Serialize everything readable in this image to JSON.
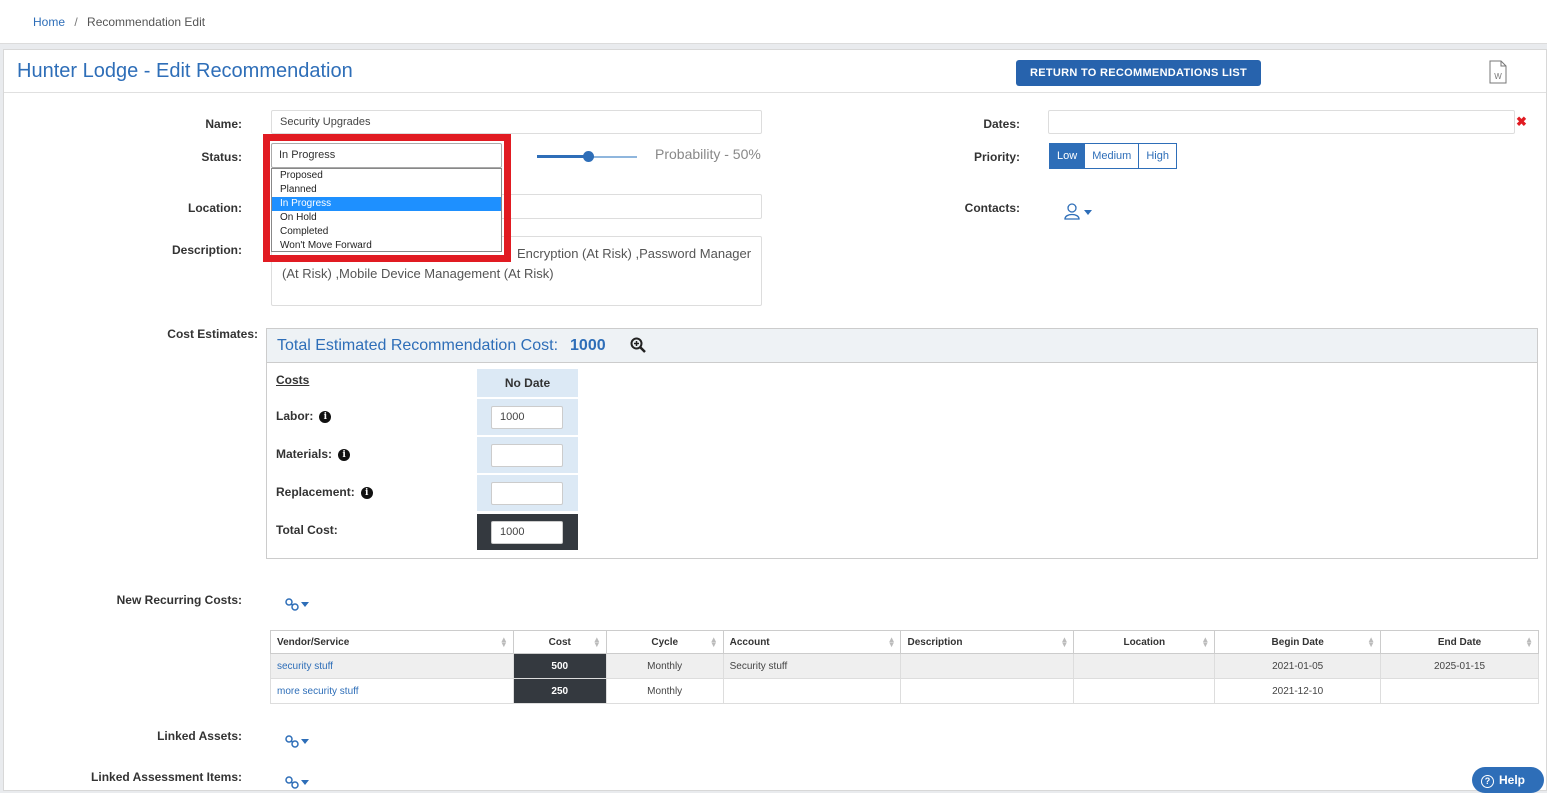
{
  "breadcrumb": {
    "home": "Home",
    "separator": "/",
    "current": "Recommendation Edit"
  },
  "header": {
    "title": "Hunter Lodge - Edit Recommendation",
    "return_button": "RETURN TO RECOMMENDATIONS LIST"
  },
  "form": {
    "name_label": "Name:",
    "name_value": "Security Upgrades",
    "status_label": "Status:",
    "status_value": "In Progress",
    "status_options": [
      "Proposed",
      "Planned",
      "In Progress",
      "On Hold",
      "Completed",
      "Won't Move Forward"
    ],
    "probability_text": "Probability - 50%",
    "probability_value": 50,
    "location_label": "Location:",
    "description_label": "Description:",
    "description_line1": "Encryption (At Risk) ,Password Manager",
    "description_line2": "(At Risk) ,Mobile Device Management (At Risk)",
    "dates_label": "Dates:",
    "priority_label": "Priority:",
    "priority_options": [
      "Low",
      "Medium",
      "High"
    ],
    "priority_selected": "Low",
    "contacts_label": "Contacts:"
  },
  "costs": {
    "section_label": "Cost Estimates:",
    "total_title": "Total Estimated Recommendation Cost:",
    "total_value": "1000",
    "costs_header": "Costs",
    "column_header": "No Date",
    "labor_label": "Labor:",
    "labor_value": "1000",
    "materials_label": "Materials:",
    "materials_value": "",
    "replacement_label": "Replacement:",
    "replacement_value": "",
    "total_label": "Total Cost:",
    "total_cost_value": "1000"
  },
  "recurring": {
    "label": "New Recurring Costs:",
    "columns": [
      "Vendor/Service",
      "Cost",
      "Cycle",
      "Account",
      "Description",
      "Location",
      "Begin Date",
      "End Date"
    ],
    "rows": [
      {
        "vendor": "security stuff",
        "cost": "500",
        "cycle": "Monthly",
        "account": "Security stuff",
        "description": "",
        "location": "",
        "begin": "2021-01-05",
        "end": "2025-01-15"
      },
      {
        "vendor": "more security stuff",
        "cost": "250",
        "cycle": "Monthly",
        "account": "",
        "description": "",
        "location": "",
        "begin": "2021-12-10",
        "end": ""
      }
    ]
  },
  "linked": {
    "assets_label": "Linked Assets:",
    "assessment_label": "Linked Assessment Items:"
  },
  "help": {
    "label": "Help"
  },
  "colors": {
    "accent": "#2e6eb8",
    "highlight": "#e11b22",
    "dark_cell": "#34393f"
  }
}
